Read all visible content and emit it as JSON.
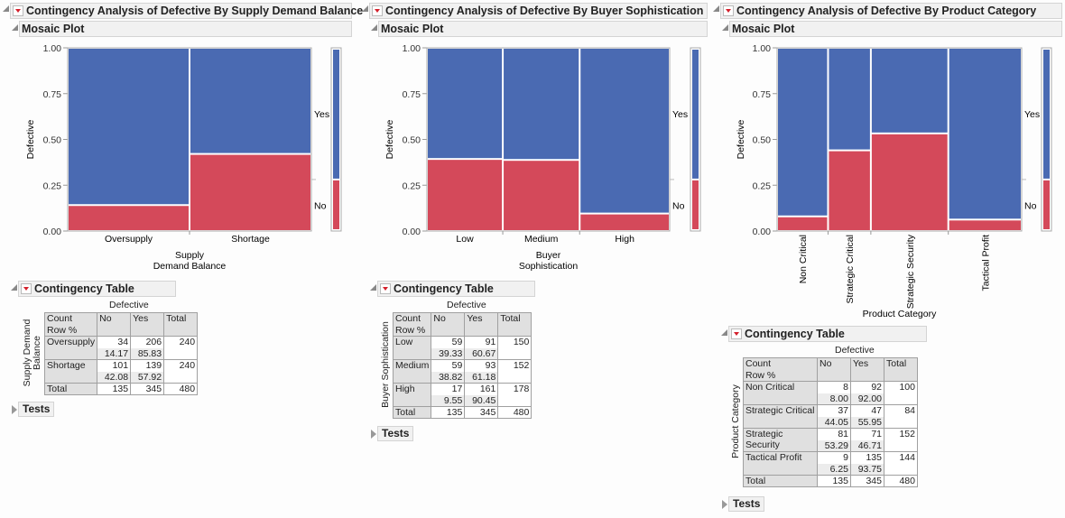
{
  "colors": {
    "yes": "#4a6ab2",
    "no": "#d4495a",
    "header_bg": "#f1f1f1",
    "red_menu": "#d4202c"
  },
  "labels": {
    "mosaic_plot": "Mosaic Plot",
    "contingency_table": "Contingency Table",
    "tests": "Tests",
    "count": "Count",
    "row_pct": "Row %",
    "total": "Total",
    "defective": "Defective",
    "yes": "Yes",
    "no": "No"
  },
  "chart_data": [
    {
      "type": "mosaic",
      "title": "Contingency Analysis of Defective By Supply Demand Balance",
      "xlabel": "Supply\nDemand Balance",
      "xlabel_lines": [
        "Supply",
        "Demand Balance"
      ],
      "table_row_label_lines": [
        "Supply Demand",
        "Balance"
      ],
      "ylabel": "Defective",
      "yticks": [
        "0.00",
        "0.25",
        "0.50",
        "0.75",
        "1.00"
      ],
      "ylim": [
        0,
        1
      ],
      "categories": [
        "Oversupply",
        "Shortage"
      ],
      "series": [
        {
          "name": "No",
          "counts": [
            34,
            101
          ],
          "row_pct": [
            "14.17",
            "42.08"
          ]
        },
        {
          "name": "Yes",
          "counts": [
            206,
            139
          ],
          "row_pct": [
            "85.83",
            "57.92"
          ]
        }
      ],
      "row_totals": [
        240,
        240
      ],
      "col_totals": {
        "No": 135,
        "Yes": 345,
        "Total": 480
      },
      "legend": [
        "Yes",
        "No"
      ]
    },
    {
      "type": "mosaic",
      "title": "Contingency Analysis of Defective By Buyer Sophistication",
      "xlabel": "Buyer\nSophistication",
      "xlabel_lines": [
        "Buyer",
        "Sophistication"
      ],
      "table_row_label_lines": [
        "Buyer Sophistication"
      ],
      "ylabel": "Defective",
      "yticks": [
        "0.00",
        "0.25",
        "0.50",
        "0.75",
        "1.00"
      ],
      "ylim": [
        0,
        1
      ],
      "categories": [
        "Low",
        "Medium",
        "High"
      ],
      "series": [
        {
          "name": "No",
          "counts": [
            59,
            59,
            17
          ],
          "row_pct": [
            "39.33",
            "38.82",
            "9.55"
          ]
        },
        {
          "name": "Yes",
          "counts": [
            91,
            93,
            161
          ],
          "row_pct": [
            "60.67",
            "61.18",
            "90.45"
          ]
        }
      ],
      "row_totals": [
        150,
        152,
        178
      ],
      "col_totals": {
        "No": 135,
        "Yes": 345,
        "Total": 480
      },
      "legend": [
        "Yes",
        "No"
      ]
    },
    {
      "type": "mosaic",
      "title": "Contingency Analysis of Defective By Product Category",
      "xlabel": "Product Category",
      "xlabel_lines": [
        "Product Category"
      ],
      "table_row_label_lines": [
        "Product Category"
      ],
      "ylabel": "Defective",
      "yticks": [
        "0.00",
        "0.25",
        "0.50",
        "0.75",
        "1.00"
      ],
      "ylim": [
        0,
        1
      ],
      "categories": [
        "Non Critical",
        "Strategic Critical",
        "Strategic Security",
        "Tactical Profit"
      ],
      "series": [
        {
          "name": "No",
          "counts": [
            8,
            37,
            81,
            9
          ],
          "row_pct": [
            "8.00",
            "44.05",
            "53.29",
            "6.25"
          ]
        },
        {
          "name": "Yes",
          "counts": [
            92,
            47,
            71,
            135
          ],
          "row_pct": [
            "92.00",
            "55.95",
            "46.71",
            "93.75"
          ]
        }
      ],
      "row_totals": [
        100,
        84,
        152,
        144
      ],
      "col_totals": {
        "No": 135,
        "Yes": 345,
        "Total": 480
      },
      "legend": [
        "Yes",
        "No"
      ]
    }
  ]
}
